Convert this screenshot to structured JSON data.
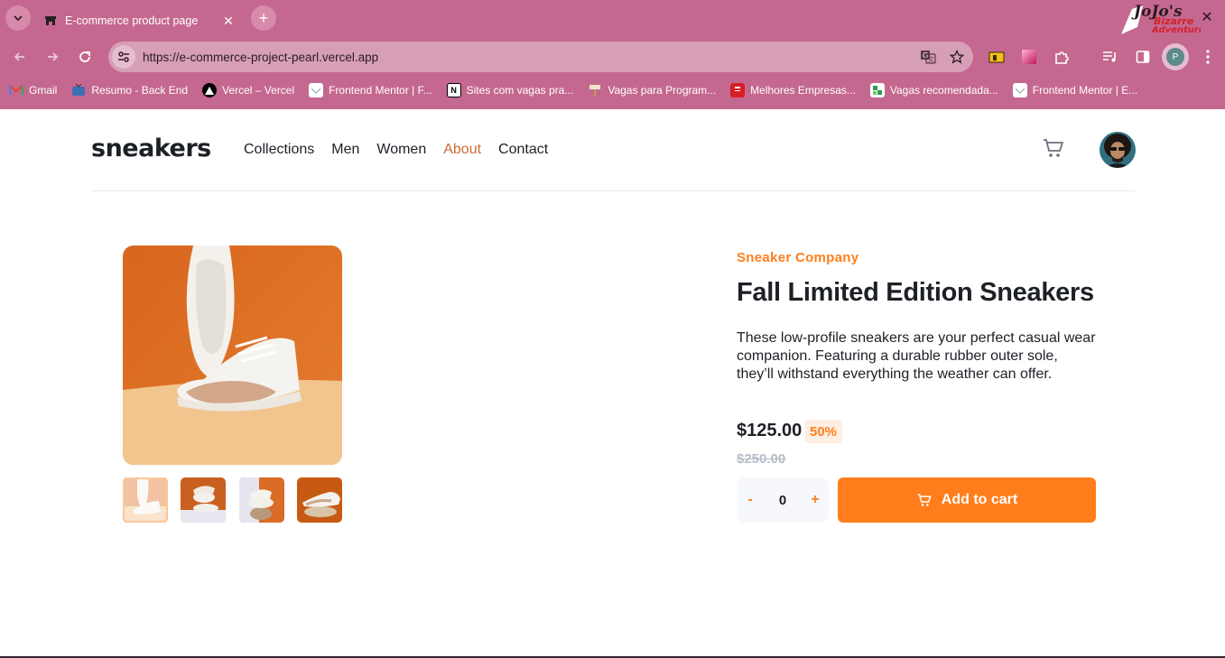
{
  "browser": {
    "tab_title": "E-commerce product page",
    "url": "https://e-commerce-project-pearl.vercel.app",
    "profile_initial": "P",
    "bookmarks": [
      {
        "label": "Gmail",
        "icon": "gmail-icon"
      },
      {
        "label": "Resumo - Back End",
        "icon": "tv-icon"
      },
      {
        "label": "Vercel – Vercel",
        "icon": "vercel-icon"
      },
      {
        "label": "Frontend Mentor | F...",
        "icon": "frontend-mentor-icon"
      },
      {
        "label": "Sites com vagas pra...",
        "icon": "notion-icon"
      },
      {
        "label": "Vagas para Program...",
        "icon": "hammer-icon"
      },
      {
        "label": "Melhores Empresas...",
        "icon": "gptw-icon"
      },
      {
        "label": "Vagas recomendada...",
        "icon": "puzzle-green-icon"
      },
      {
        "label": "Frontend Mentor | E...",
        "icon": "frontend-mentor-icon"
      }
    ]
  },
  "site": {
    "logo": "sneakers",
    "nav": [
      "Collections",
      "Men",
      "Women",
      "About",
      "Contact"
    ],
    "active_nav": "About"
  },
  "product": {
    "company": "Sneaker Company",
    "title": "Fall Limited Edition Sneakers",
    "description": "These low-profile sneakers are your perfect casual wear companion. Featuring a durable rubber outer sole, they’ll withstand everything the weather can offer.",
    "price": "$125.00",
    "discount": "50%",
    "old_price": "$250.00",
    "quantity": "0",
    "minus_label": "-",
    "plus_label": "+",
    "add_to_cart_label": "Add to cart"
  },
  "colors": {
    "chrome": "#c4688f",
    "accent": "#ff7e1b",
    "active_nav": "#cc6a34",
    "text": "#1d2026",
    "muted": "#b6bcc8"
  }
}
